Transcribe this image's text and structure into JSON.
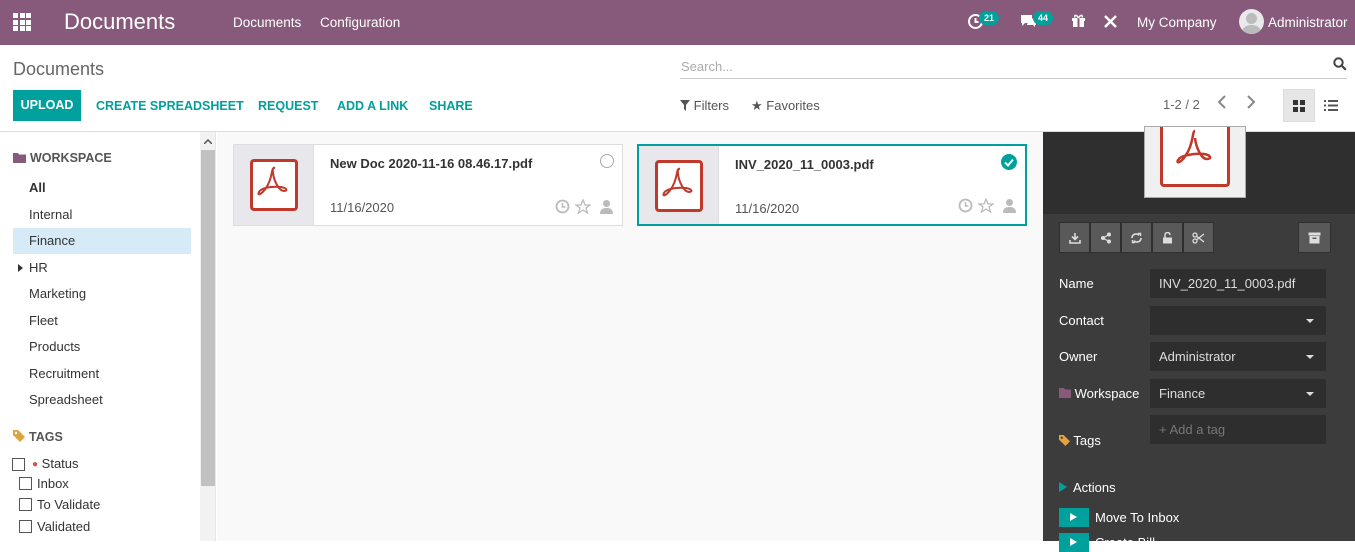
{
  "topbar": {
    "app_title": "Documents",
    "menu": [
      "Documents",
      "Configuration"
    ],
    "activity_count": "21",
    "message_count": "44",
    "company": "My Company",
    "user": "Administrator"
  },
  "control_panel": {
    "breadcrumb": "Documents",
    "search_placeholder": "Search...",
    "buttons": {
      "upload": "UPLOAD",
      "create_spreadsheet": "CREATE SPREADSHEET",
      "request": "REQUEST",
      "add_link": "ADD A LINK",
      "share": "SHARE"
    },
    "filters": "Filters",
    "favorites": "Favorites",
    "pager": "1-2 / 2"
  },
  "sidebar": {
    "workspace_header": "WORKSPACE",
    "workspaces": [
      "All",
      "Internal",
      "Finance",
      "HR",
      "Marketing",
      "Fleet",
      "Products",
      "Recruitment",
      "Spreadsheet"
    ],
    "active_workspace": "Finance",
    "tags_header": "TAGS",
    "tag_group": "Status",
    "tags": [
      "Inbox",
      "To Validate",
      "Validated"
    ]
  },
  "documents": [
    {
      "name": "New Doc 2020-11-16 08.46.17.pdf",
      "date": "11/16/2020",
      "selected": false
    },
    {
      "name": "INV_2020_11_0003.pdf",
      "date": "11/16/2020",
      "selected": true
    }
  ],
  "panel": {
    "labels": {
      "name": "Name",
      "contact": "Contact",
      "owner": "Owner",
      "workspace": "Workspace",
      "tags": "Tags",
      "actions": "Actions"
    },
    "values": {
      "name": "INV_2020_11_0003.pdf",
      "contact": "",
      "owner": "Administrator",
      "workspace": "Finance",
      "tag_placeholder": "+ Add a tag"
    },
    "actions": [
      "Move To Inbox",
      "Create Bill"
    ]
  },
  "colors": {
    "brand": "#875a7b",
    "accent": "#00a09d",
    "pdf_red": "#c0392b",
    "panel_bg": "#3c3c3c"
  }
}
